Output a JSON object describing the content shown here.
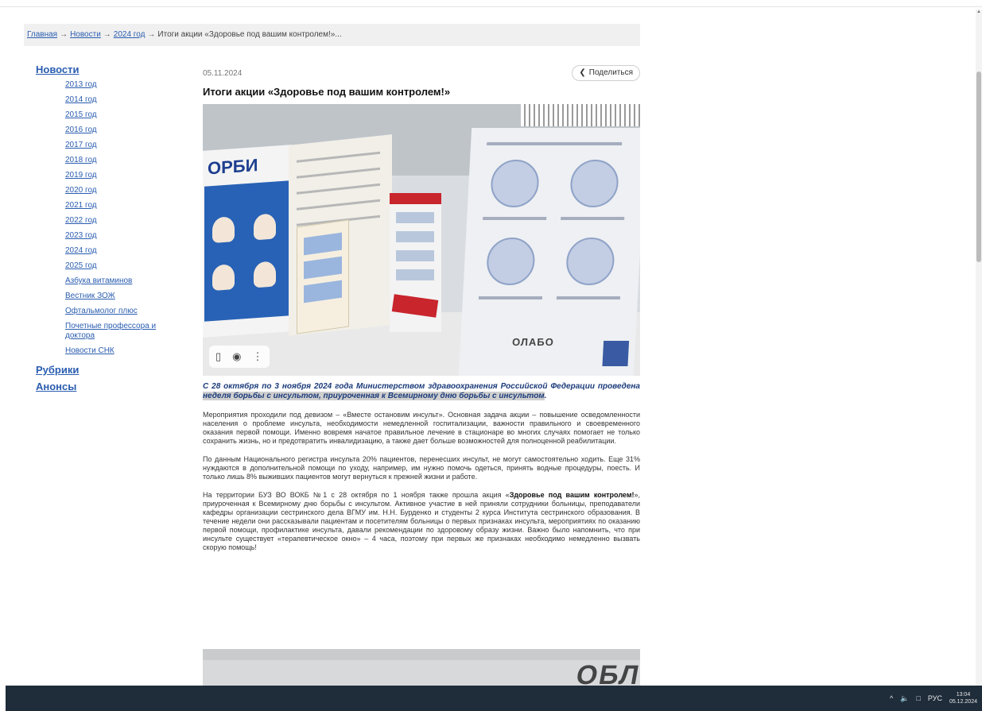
{
  "breadcrumb": {
    "items": [
      "Главная",
      "Новости",
      "2024 год"
    ],
    "separator": "→",
    "current": "Итоги акции «Здоровье под вашим контролем!»..."
  },
  "sidebar": {
    "news_title": "Новости",
    "news_items": [
      "2013 год",
      "2014 год",
      "2015 год",
      "2016 год",
      "2017 год",
      "2018 год",
      "2019 год",
      "2020 год",
      "2021 год",
      "2022 год",
      "2023 год",
      "2024 год",
      "2025 год",
      "Азбука витаминов",
      "Вестник ЗОЖ",
      "Офтальмолог плюс",
      "Почетные профессора и доктора",
      "Новости СНК"
    ],
    "rubrics_title": "Рубрики",
    "announcements_title": "Анонсы"
  },
  "article": {
    "date": "05.11.2024",
    "share_label": "Поделиться",
    "share_icon": "share-icon",
    "title": "Итоги акции «Здоровье под вашим контролем!»",
    "photo": {
      "stand_header": "ОРБИ",
      "brand_logo": "ОЛАБО"
    },
    "photo_tools": [
      "bookmark-icon",
      "camera-icon",
      "more-icon"
    ],
    "lead_plain": "С 28 октября по 3 ноября 2024 года Министерством здравоохранения Российской Федерации проведена ",
    "lead_highlight": "неделя борьбы с инсультом, приуроченная к Всемирному дню борьбы с инсультом",
    "lead_end": ".",
    "paragraph1": "Мероприятия проходили под девизом – «Вместе остановим инсульт». Основная задача акции – повышение осведомленности населения о проблеме инсульта, необходимости немедленной госпитализации, важности правильного и своевременного оказания первой помощи. Именно вовремя начатое правильное лечение в стационаре во многих случаях помогает не только сохранить жизнь, но и предотвратить инвалидизацию, а также дает больше возможностей для полноценной реабилитации.",
    "paragraph2": "По данным Национального регистра инсульта 20% пациентов, перенесших инсульт, не могут самостоятельно ходить. Еще 31% нуждаются в дополнительной помощи по уходу, например, им нужно помочь одеться, принять водные процедуры, поесть. И только лишь 8% выживших пациентов могут вернуться к прежней жизни и работе.",
    "paragraph3_start": "На территории БУЗ ВО ВОКБ №1 с 28 октября по 1 ноября также прошла акция «",
    "paragraph3_bold": "Здоровье под вашим контролем!",
    "paragraph3_end": "», приуроченная к Всемирному дню борьбы с инсультом. Активное участие в ней приняли сотрудники больницы, преподаватели кафедры организации сестринского дела ВГМУ им. Н.Н. Бурденко и студенты 2 курса Института сестринского образования. В течение недели они рассказывали пациентам и посетителям больницы о первых признаках инсульта, мероприятиях по оказанию первой помощи, профилактике инсульта, давали рекомендации по здоровому образу жизни. Важно было напомнить, что при инсульте существует «терапевтическое окно» – 4 часа, поэтому при первых же признаках необходимо немедленно вызвать скорую помощь!",
    "photo2_text": "ОБЛ"
  },
  "taskbar": {
    "tray_chevron": "^",
    "volume_icon": "speaker-icon",
    "network_icon": "network-icon",
    "language": "РУС",
    "time": "13:04",
    "date": "05.12.2024"
  }
}
